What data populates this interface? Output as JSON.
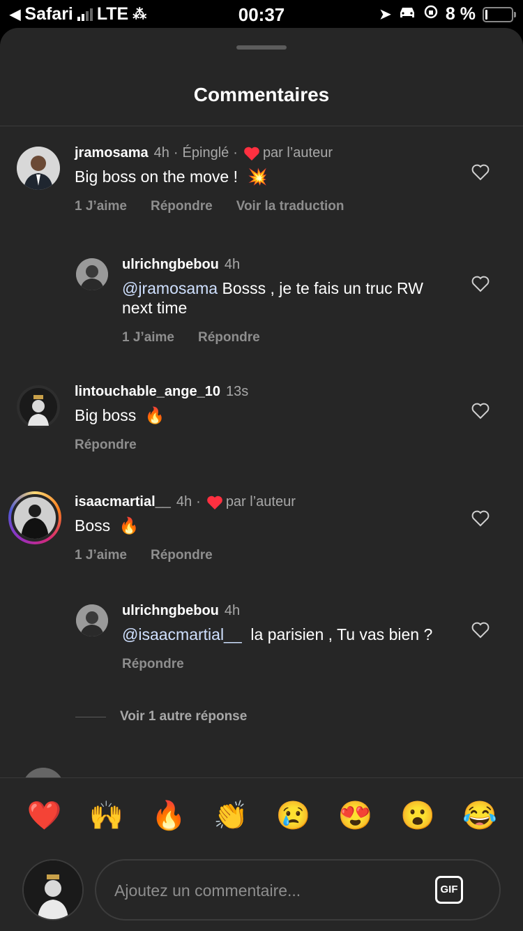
{
  "status_bar": {
    "back_app": "Safari",
    "network": "LTE",
    "time": "00:37",
    "battery": "8 %",
    "battery_level": 0.08
  },
  "sheet": {
    "title": "Commentaires"
  },
  "comments": [
    {
      "username": "jramosama",
      "time": "4h",
      "pinned": "Épinglé",
      "liked_by_author": "par l’auteur",
      "text": "Big boss on the move !",
      "emoji": "💥",
      "likes": "1 J’aime",
      "reply": "Répondre",
      "translate": "Voir la traduction"
    },
    {
      "username": "ulrichngbebou",
      "time": "4h",
      "mention": "@jramosama",
      "text": " Bosss , je te fais un truc RW next time",
      "likes": "1 J’aime",
      "reply": "Répondre"
    },
    {
      "username": "lintouchable_ange_10",
      "time": "13s",
      "text": "Big boss",
      "emoji": "🔥",
      "reply": "Répondre"
    },
    {
      "username": "isaacmartial__",
      "time": "4h",
      "liked_by_author": "par l’auteur",
      "text": "Boss",
      "emoji": "🔥",
      "likes": "1 J’aime",
      "reply": "Répondre"
    },
    {
      "username": "ulrichngbebou",
      "time": "4h",
      "mention": "@isaacmartial__",
      "text": "  la parisien , Tu vas bien ?",
      "reply": "Répondre"
    }
  ],
  "view_more_replies": "Voir 1 autre réponse",
  "quick_reactions": [
    "❤️",
    "🙌",
    "🔥",
    "👏",
    "😢",
    "😍",
    "😮",
    "😂"
  ],
  "composer": {
    "placeholder": "Ajoutez un commentaire...",
    "gif_label": "GIF"
  },
  "colors": {
    "sheet_bg": "#262626",
    "heart_red": "#ff3040",
    "mention": "#cfe0ff",
    "muted": "#a8a8a8"
  }
}
